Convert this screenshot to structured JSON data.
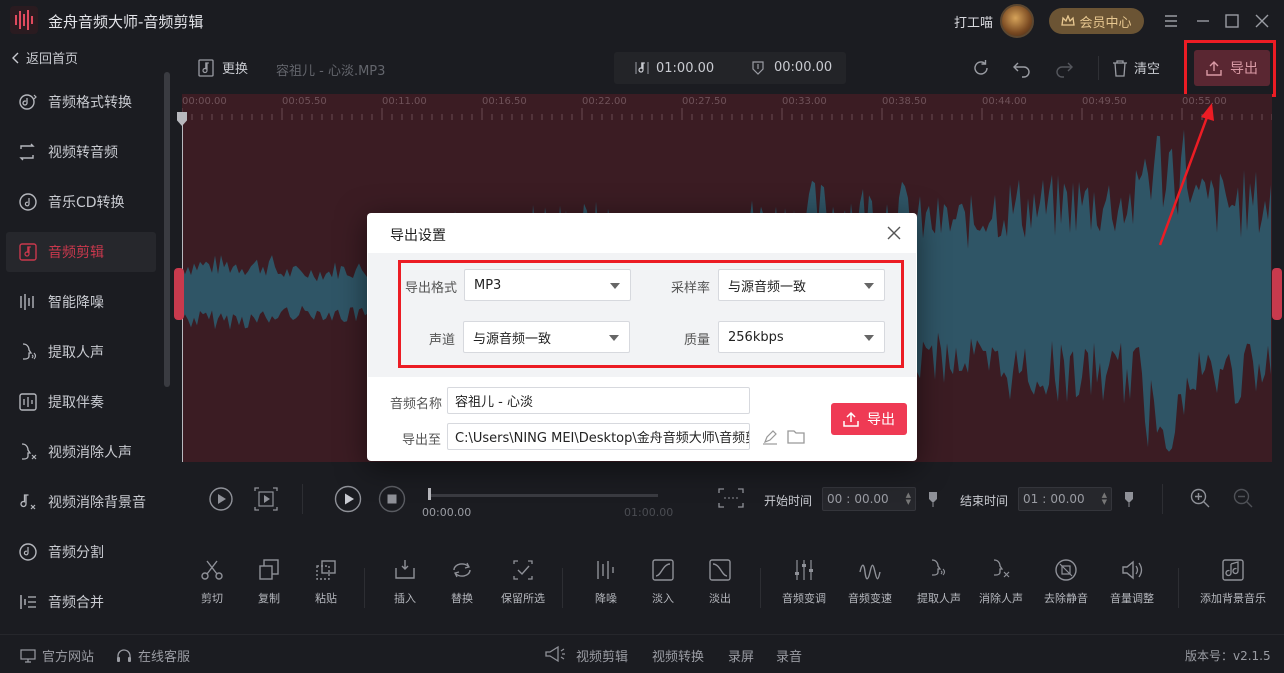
{
  "app": {
    "title": "金舟音频大师-音频剪辑"
  },
  "header": {
    "user_name": "打工喵",
    "member_label": "会员中心",
    "window_buttons": [
      "menu-icon",
      "minimize-icon",
      "maximize-icon",
      "close-icon"
    ]
  },
  "sidebar": {
    "back_label": "返回首页",
    "active_index": 3,
    "items": [
      {
        "label": "音频格式转换",
        "icon": "audio-format-icon"
      },
      {
        "label": "视频转音频",
        "icon": "video-to-audio-icon"
      },
      {
        "label": "音乐CD转换",
        "icon": "cd-icon"
      },
      {
        "label": "音频剪辑",
        "icon": "audio-edit-icon"
      },
      {
        "label": "智能降噪",
        "icon": "denoise-icon"
      },
      {
        "label": "提取人声",
        "icon": "voice-extract-icon"
      },
      {
        "label": "提取伴奏",
        "icon": "accompaniment-icon"
      },
      {
        "label": "视频消除人声",
        "icon": "video-remove-voice-icon"
      },
      {
        "label": "视频消除背景音",
        "icon": "video-remove-bg-icon"
      },
      {
        "label": "音频分割",
        "icon": "audio-split-icon"
      },
      {
        "label": "音频合并",
        "icon": "audio-merge-icon"
      }
    ]
  },
  "toolbar": {
    "replace_label": "更换",
    "file_name": "容祖儿 - 心淡.MP3",
    "total_time": "01:00.00",
    "current_time": "00:00.00",
    "clear_label": "清空",
    "export_label": "导出"
  },
  "ruler": {
    "labels": [
      "00:00.00",
      "00:05.50",
      "00:11.00",
      "00:16.50",
      "00:22.00",
      "00:27.50",
      "00:33.00",
      "00:38.50",
      "00:44.00",
      "00:49.50",
      "00:55.00"
    ]
  },
  "transport": {
    "position": "00:00.00",
    "duration": "01:00.00",
    "start_label": "开始时间",
    "start_min": "00",
    "start_sec": "00.00",
    "end_label": "结束时间",
    "end_min": "01",
    "end_sec": "00.00"
  },
  "tools": [
    {
      "label": "剪切",
      "icon": "scissors-icon"
    },
    {
      "label": "复制",
      "icon": "copy-icon"
    },
    {
      "label": "粘贴",
      "icon": "paste-icon"
    },
    {
      "label": "插入",
      "icon": "insert-icon"
    },
    {
      "label": "替换",
      "icon": "replace-icon"
    },
    {
      "label": "保留所选",
      "icon": "keep-selection-icon"
    },
    {
      "label": "降噪",
      "icon": "noise-reduce-icon"
    },
    {
      "label": "淡入",
      "icon": "fade-in-icon"
    },
    {
      "label": "淡出",
      "icon": "fade-out-icon"
    },
    {
      "label": "音频变调",
      "icon": "pitch-icon"
    },
    {
      "label": "音频变速",
      "icon": "speed-icon"
    },
    {
      "label": "提取人声",
      "icon": "voice-extract-icon"
    },
    {
      "label": "消除人声",
      "icon": "remove-voice-icon"
    },
    {
      "label": "去除静音",
      "icon": "remove-silence-icon"
    },
    {
      "label": "音量调整",
      "icon": "volume-icon"
    },
    {
      "label": "添加背景音乐",
      "icon": "add-music-icon"
    }
  ],
  "status": {
    "website": "官方网站",
    "support": "在线客服",
    "links": [
      "视频剪辑",
      "视频转换",
      "录屏",
      "录音"
    ],
    "version": "版本号：v2.1.5"
  },
  "dialog": {
    "title": "导出设置",
    "format_label": "导出格式",
    "format_value": "MP3",
    "samplerate_label": "采样率",
    "samplerate_value": "与源音频一致",
    "channel_label": "声道",
    "channel_value": "与源音频一致",
    "quality_label": "质量",
    "quality_value": "256kbps",
    "name_label": "音频名称",
    "name_value": "容祖儿 - 心淡",
    "path_label": "导出至",
    "path_value": "C:\\Users\\NING MEI\\Desktop\\金舟音频大师\\音频剪辑",
    "export_label": "导出"
  },
  "colors": {
    "accent": "#ef3a54",
    "annotation": "#ec1c24",
    "waveform": "#2f5566",
    "selection_bg": "#3b1c23"
  }
}
